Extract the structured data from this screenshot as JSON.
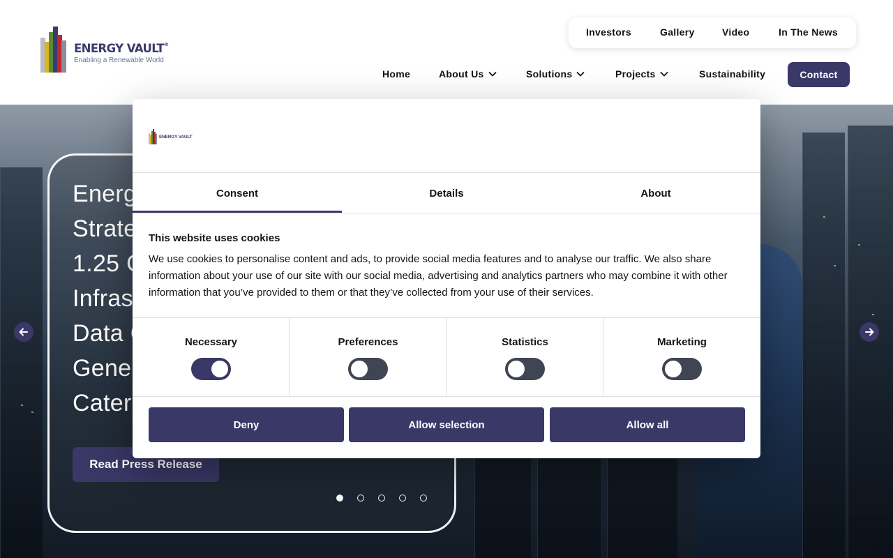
{
  "brand": {
    "name": "ENERGY VAULT",
    "registered_mark": "®",
    "tagline": "Enabling a Renewable World",
    "colors": {
      "primary": "#3a3867",
      "logo_bars": [
        "#8a8f9e",
        "#d9b521",
        "#5a8a3a",
        "#3a3b6e",
        "#c2272d",
        "#b9bcc6"
      ]
    }
  },
  "top_nav": [
    {
      "label": "Investors"
    },
    {
      "label": "Gallery"
    },
    {
      "label": "Video"
    },
    {
      "label": "In The News"
    }
  ],
  "main_nav": [
    {
      "label": "Home",
      "has_dropdown": false
    },
    {
      "label": "About Us",
      "has_dropdown": true
    },
    {
      "label": "Solutions",
      "has_dropdown": true
    },
    {
      "label": "Projects",
      "has_dropdown": true
    },
    {
      "label": "Sustainability",
      "has_dropdown": false
    }
  ],
  "contact_label": "Contact",
  "hero": {
    "headline_lines": [
      "Energ",
      "Strate",
      "1.25 G",
      "Infras",
      "Data C",
      "Gener",
      "Cater"
    ],
    "cta_label": "Read Press Release",
    "slide_count": 5,
    "active_slide": 1,
    "prev_icon": "arrow-left-icon",
    "next_icon": "arrow-right-icon"
  },
  "cookie_dialog": {
    "logo_text": "ENERGY VAULT",
    "tabs": [
      {
        "label": "Consent",
        "active": true
      },
      {
        "label": "Details",
        "active": false
      },
      {
        "label": "About",
        "active": false
      }
    ],
    "title": "This website uses cookies",
    "body": "We use cookies to personalise content and ads, to provide social media features and to analyse our traffic. We also share information about your use of our site with our social media, advertising and analytics partners who may combine it with other information that you’ve provided to them or that they’ve collected from your use of their services.",
    "categories": [
      {
        "label": "Necessary",
        "enabled": true
      },
      {
        "label": "Preferences",
        "enabled": false
      },
      {
        "label": "Statistics",
        "enabled": false
      },
      {
        "label": "Marketing",
        "enabled": false
      }
    ],
    "buttons": {
      "deny": "Deny",
      "allow_selection": "Allow selection",
      "allow_all": "Allow all"
    }
  }
}
